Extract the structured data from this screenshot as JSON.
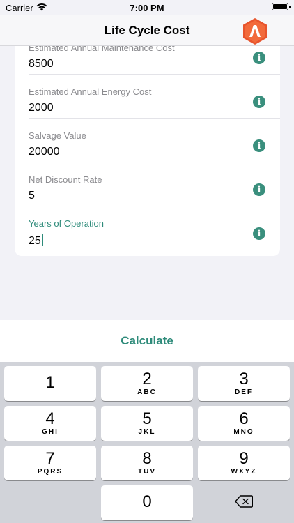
{
  "status_bar": {
    "carrier": "Carrier",
    "time": "7:00 PM"
  },
  "nav": {
    "title": "Life Cycle Cost",
    "logo_icon": "app-logo-icon",
    "logo_color": "#e8542c"
  },
  "form": {
    "fields": [
      {
        "label": "Estimated Annual Maintenance Cost",
        "value": "8500"
      },
      {
        "label": "Estimated Annual Energy Cost",
        "value": "2000"
      },
      {
        "label": "Salvage Value",
        "value": "20000"
      },
      {
        "label": "Net Discount Rate",
        "value": "5"
      },
      {
        "label": "Years of Operation",
        "value": "25"
      }
    ],
    "info_icon_glyph": "i",
    "accent_color": "#2e8b7a"
  },
  "calculate": {
    "label": "Calculate"
  },
  "keypad": {
    "keys": [
      {
        "num": "1",
        "letters": ""
      },
      {
        "num": "2",
        "letters": "ABC"
      },
      {
        "num": "3",
        "letters": "DEF"
      },
      {
        "num": "4",
        "letters": "GHI"
      },
      {
        "num": "5",
        "letters": "JKL"
      },
      {
        "num": "6",
        "letters": "MNO"
      },
      {
        "num": "7",
        "letters": "PQRS"
      },
      {
        "num": "8",
        "letters": "TUV"
      },
      {
        "num": "9",
        "letters": "WXYZ"
      },
      {
        "num": "0",
        "letters": ""
      }
    ],
    "delete_icon": "backspace-icon"
  }
}
